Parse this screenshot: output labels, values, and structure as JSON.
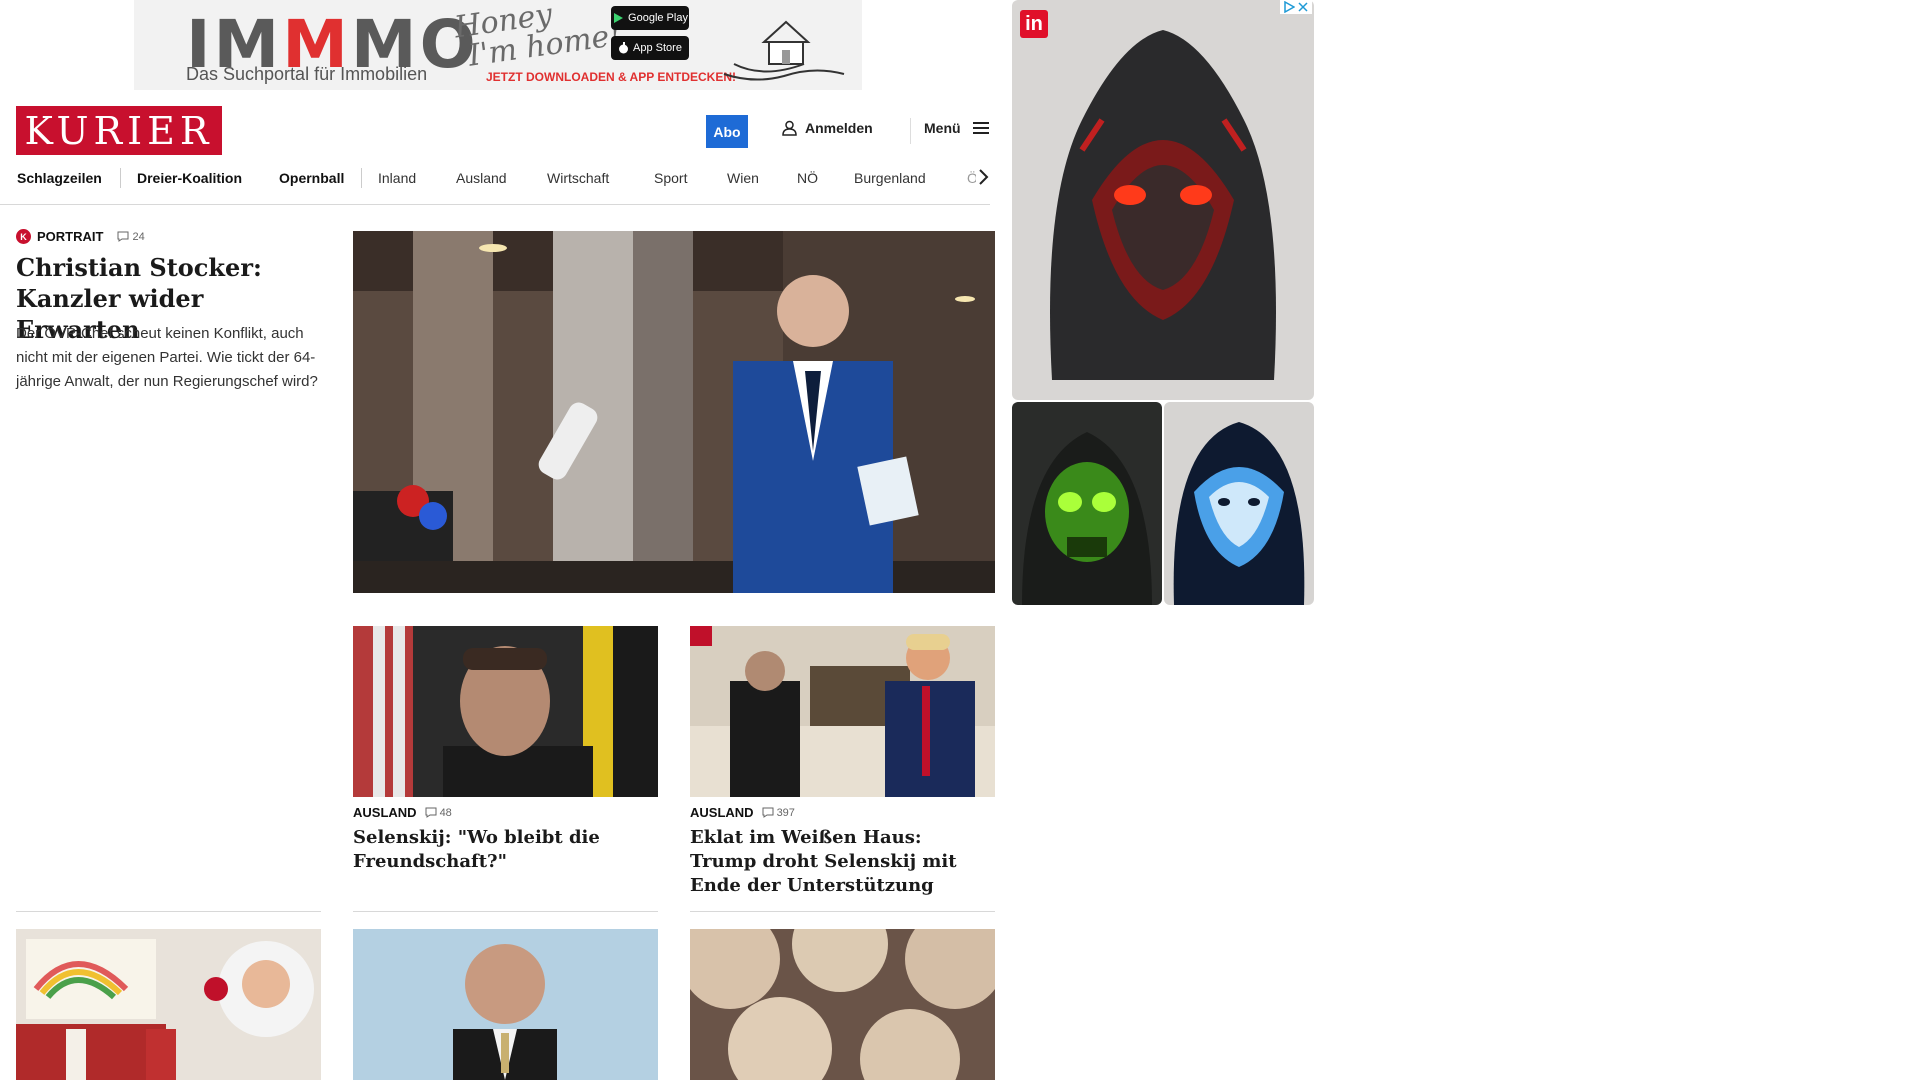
{
  "top_ad": {
    "brand_a": "IM",
    "brand_b": "M",
    "brand_c": "MO",
    "script_1": "Honey",
    "script_2": "I'm home!",
    "tagline": "Das Suchportal für Immobilien",
    "google_play": "Google Play",
    "app_store": "App Store",
    "cta": "JETZT DOWNLOADEN & APP ENTDECKEN!"
  },
  "header": {
    "logo": "KURIER",
    "abo": "Abo",
    "login": "Anmelden",
    "menu": "Menü"
  },
  "nav": [
    "Schlagzeilen",
    "Dreier-Koalition",
    "Opernball",
    "Inland",
    "Ausland",
    "Wirtschaft",
    "Sport",
    "Wien",
    "NÖ",
    "Burgenland",
    "Ö"
  ],
  "lead": {
    "kicker": "PORTRAIT",
    "comments": "24",
    "title": "Christian Stocker: Kanzler wider Erwarten",
    "text": "Der ÖVP-Chef scheut keinen Konflikt, auch nicht mit der eigenen Partei. Wie tickt der 64-jährige Anwalt, der nun Regierungschef wird?"
  },
  "teasers": [
    {
      "kicker": "AUSLAND",
      "comments": "48",
      "title": "Selenskij: \"Wo bleibt die Freundschaft?\""
    },
    {
      "kicker": "AUSLAND",
      "comments": "397",
      "title": "Eklat im Weißen Haus: Trump droht Selenskij mit Ende der Unterstützung"
    }
  ],
  "ad_right": {
    "badge": "in"
  },
  "colors": {
    "brand_red": "#c8102e",
    "abo_blue": "#1e6bd6"
  }
}
